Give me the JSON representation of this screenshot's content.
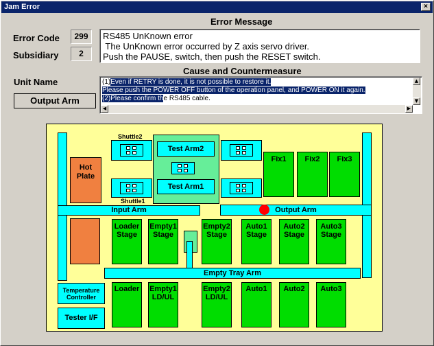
{
  "window": {
    "title": "Jam Error",
    "close_label": "×"
  },
  "error": {
    "header": "Error Message",
    "code_label": "Error Code",
    "code": "299",
    "subsidiary_label": "Subsidiary",
    "subsidiary": "2",
    "message_lines": [
      "RS485 UnKnown error",
      " The UnKnown error occurred by Z axis servo driver.",
      "Push the PAUSE, switch, then push the RESET switch."
    ]
  },
  "cause": {
    "header": "Cause and Countermeasure",
    "line1_pre": "(1)",
    "line1_sel": "Even if RETRY is done, it is not possible to restore it.",
    "line2": "Please push the POWER OFF button of the operation panel, and POWER ON it again.",
    "line3_sel": "(2)Please confirm th",
    "line3_rest": "e RS485 cable."
  },
  "unit": {
    "label": "Unit Name",
    "value": "Output Arm"
  },
  "map": {
    "hot_plate": "Hot\nPlate",
    "shuttle2": "Shuttle2",
    "shuttle1": "Shuttle1",
    "test_arm2": "Test Arm2",
    "test_arm1": "Test Arm1",
    "fix1": "Fix1",
    "fix2": "Fix2",
    "fix3": "Fix3",
    "input_arm": "Input Arm",
    "output_arm": "Output Arm",
    "loader_stage": "Loader\nStage",
    "empty1_stage": "Empty1\nStage",
    "empty2_stage": "Empty2\nStage",
    "auto1_stage": "Auto1\nStage",
    "auto2_stage": "Auto2\nStage",
    "auto3_stage": "Auto3\nStage",
    "empty_tray_arm": "Empty Tray Arm",
    "temp_controller": "Temperature\nController",
    "tester_if": "Tester I/F",
    "loader": "Loader",
    "empty1_ldul": "Empty1\nLD/UL",
    "empty2_ldul": "Empty2\nLD/UL",
    "auto1": "Auto1",
    "auto2": "Auto2",
    "auto3": "Auto3",
    "error_marker_color": "#ff0000"
  }
}
